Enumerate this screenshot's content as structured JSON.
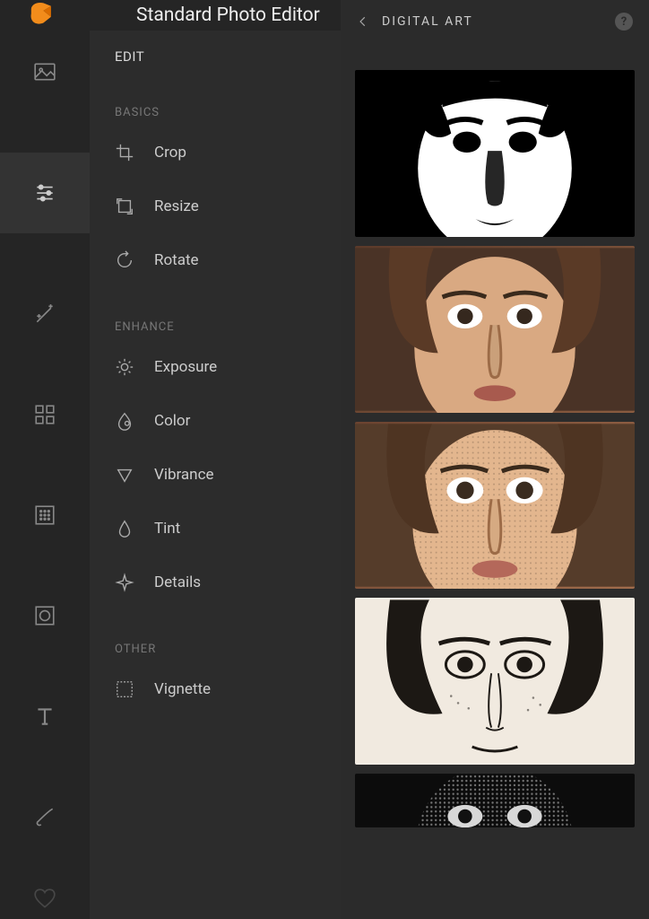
{
  "app_title": "Standard Photo Editor",
  "edit": {
    "section_title": "EDIT",
    "groups": {
      "basics": {
        "label": "BASICS",
        "tools": {
          "crop": "Crop",
          "resize": "Resize",
          "rotate": "Rotate"
        }
      },
      "enhance": {
        "label": "ENHANCE",
        "tools": {
          "exposure": "Exposure",
          "color": "Color",
          "vibrance": "Vibrance",
          "tint": "Tint",
          "details": "Details"
        }
      },
      "other": {
        "label": "OTHER",
        "tools": {
          "vignette": "Vignette"
        }
      }
    }
  },
  "right": {
    "title": "DIGITAL ART",
    "help": "?"
  },
  "nav_icons": [
    "photo",
    "sliders",
    "wand",
    "grid",
    "texture",
    "camera",
    "text",
    "brush",
    "heart"
  ]
}
